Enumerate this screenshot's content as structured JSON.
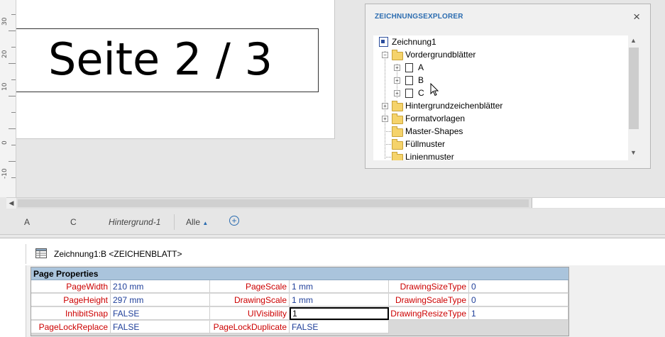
{
  "page": {
    "title": "Seite 2 / 3"
  },
  "ruler": {
    "labels": [
      "30",
      "20",
      "10",
      "0",
      "-10"
    ]
  },
  "explorer": {
    "title": "ZEICHNUNGSEXPLORER",
    "close_glyph": "×",
    "tree": {
      "root": "Zeichnung1",
      "foreground": "Vordergrundblätter",
      "pages": [
        "A",
        "B",
        "C"
      ],
      "others": [
        "Hintergrundzeichenblätter",
        "Formatvorlagen",
        "Master-Shapes",
        "Füllmuster",
        "Linienmuster"
      ]
    }
  },
  "tabs": {
    "items": [
      "A",
      "C",
      "Hintergrund-1"
    ],
    "all_label": "Alle",
    "all_arrow": "▲",
    "add_glyph": "+"
  },
  "shapesheet": {
    "title": "Zeichnung1:B <ZEICHENBLATT>",
    "section_title": "Page Properties",
    "rows": [
      [
        {
          "name": "PageWidth",
          "value": "210 mm"
        },
        {
          "name": "PageScale",
          "value": "1 mm"
        },
        {
          "name": "DrawingSizeType",
          "value": "0"
        }
      ],
      [
        {
          "name": "PageHeight",
          "value": "297 mm"
        },
        {
          "name": "DrawingScale",
          "value": "1 mm"
        },
        {
          "name": "DrawingScaleType",
          "value": "0"
        }
      ],
      [
        {
          "name": "InhibitSnap",
          "value": "FALSE"
        },
        {
          "name": "UIVisibility",
          "value": "1"
        },
        {
          "name": "DrawingResizeType",
          "value": "1"
        }
      ],
      [
        {
          "name": "PageLockReplace",
          "value": "FALSE"
        },
        {
          "name": "PageLockDuplicate",
          "value": "FALSE"
        }
      ]
    ]
  },
  "colors": {
    "accent": "#2b6cb0",
    "section_header": "#aac4dc",
    "cell_name": "#cc0000",
    "cell_value": "#1f3f9a"
  }
}
